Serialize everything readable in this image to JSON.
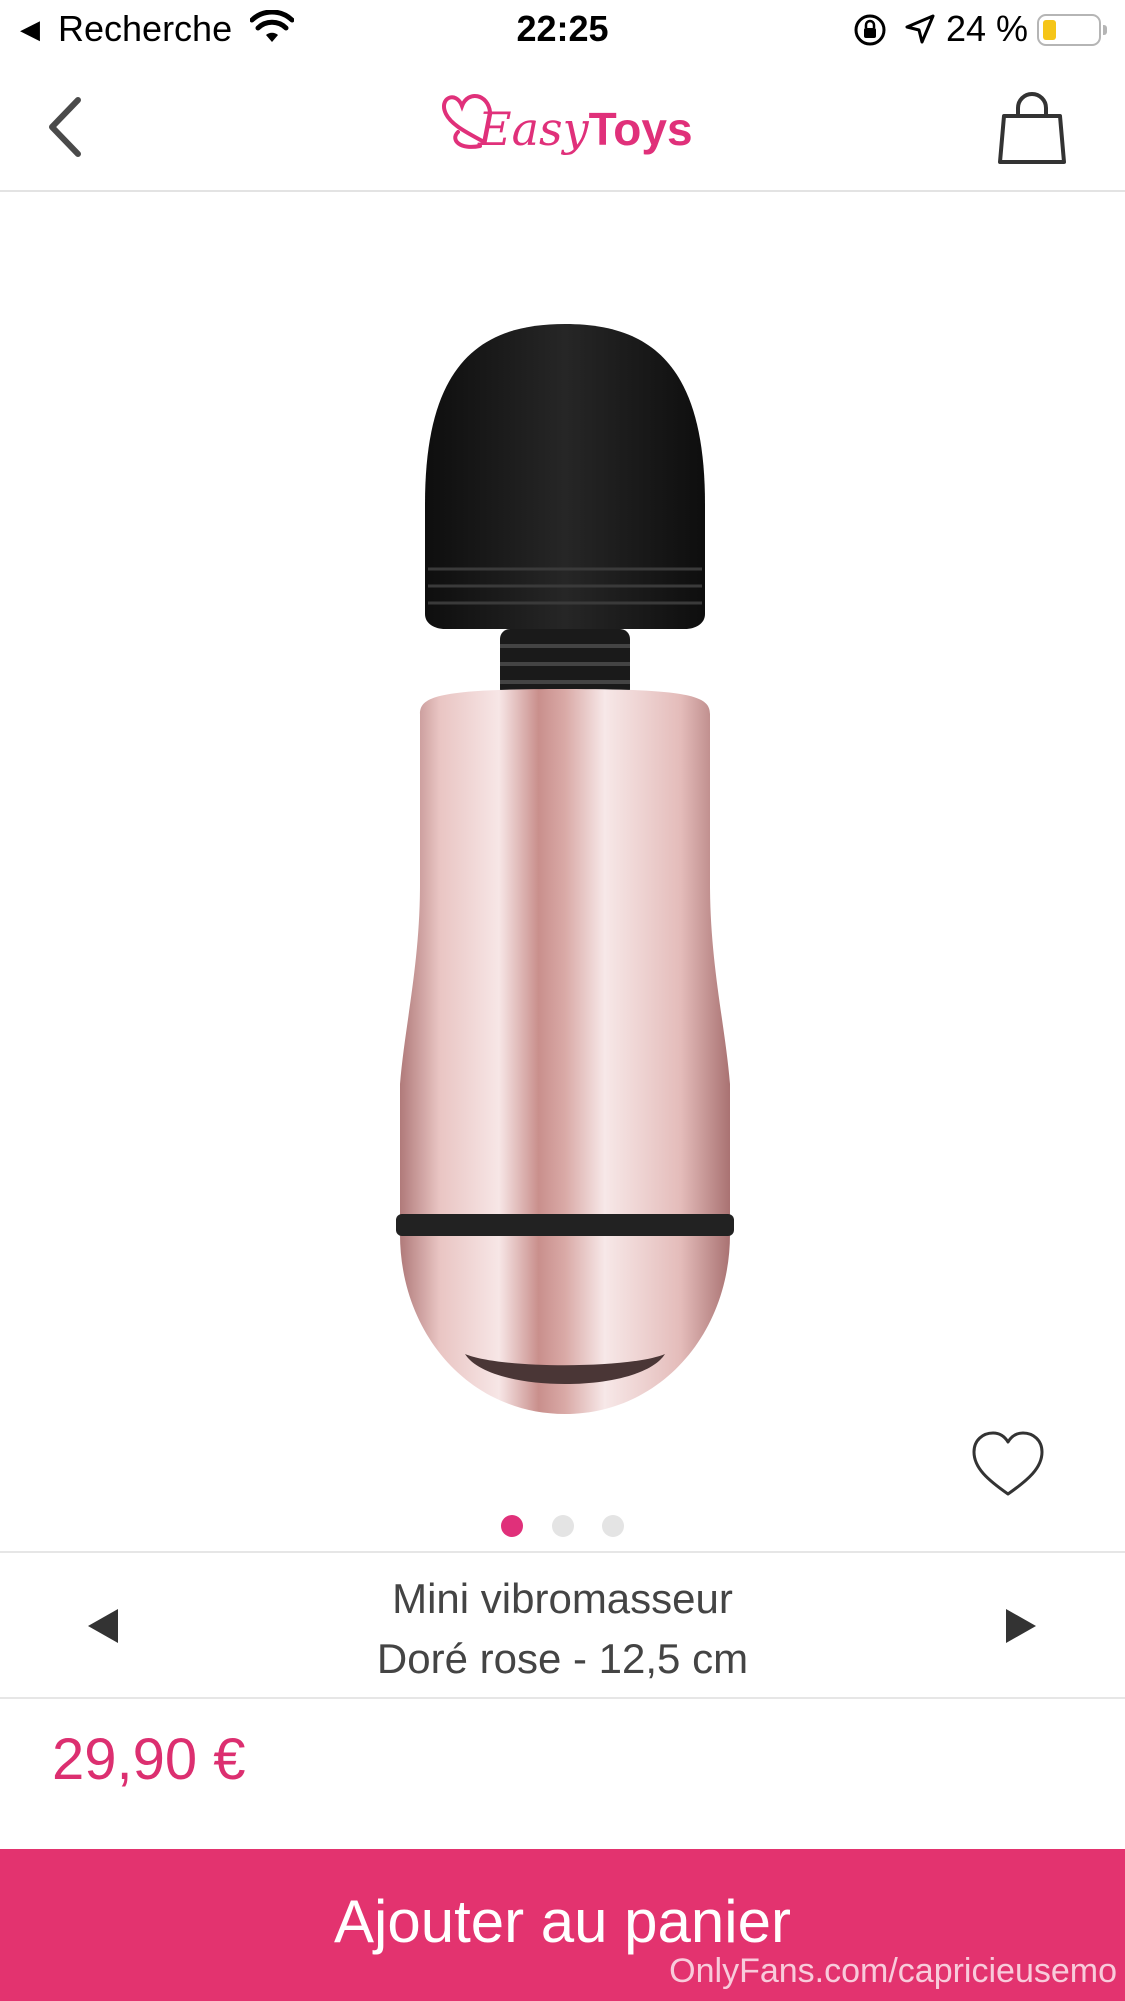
{
  "status_bar": {
    "back_glyph": "◀",
    "carrier": "Recherche",
    "time": "22:25",
    "battery_percent": "24 %",
    "battery_level": 0.24,
    "battery_color": "#f5c518",
    "icons": [
      "wifi-icon",
      "orientation-lock-icon",
      "location-arrow-icon",
      "battery-icon"
    ]
  },
  "header": {
    "logo_part1": "Easy",
    "logo_part2": "Toys",
    "brand_color": "#e0307a",
    "icons": [
      "back-chevron-icon",
      "shopping-bag-icon"
    ]
  },
  "product": {
    "image_alt_icon": "wand-vibrator-image",
    "favorite_icon": "heart-outline-icon",
    "carousel": {
      "count": 3,
      "active_index": 0
    }
  },
  "variant": {
    "line1": "Mini vibromasseur",
    "line2": "Doré rose - 12,5 cm",
    "prev_icon": "triangle-left-icon",
    "next_icon": "triangle-right-icon"
  },
  "price": {
    "value": "29,90 €",
    "color": "#dc2f70"
  },
  "cta": {
    "label": "Ajouter au panier",
    "color": "#e3336f"
  },
  "watermark": "OnlyFans.com/capricieusemo"
}
